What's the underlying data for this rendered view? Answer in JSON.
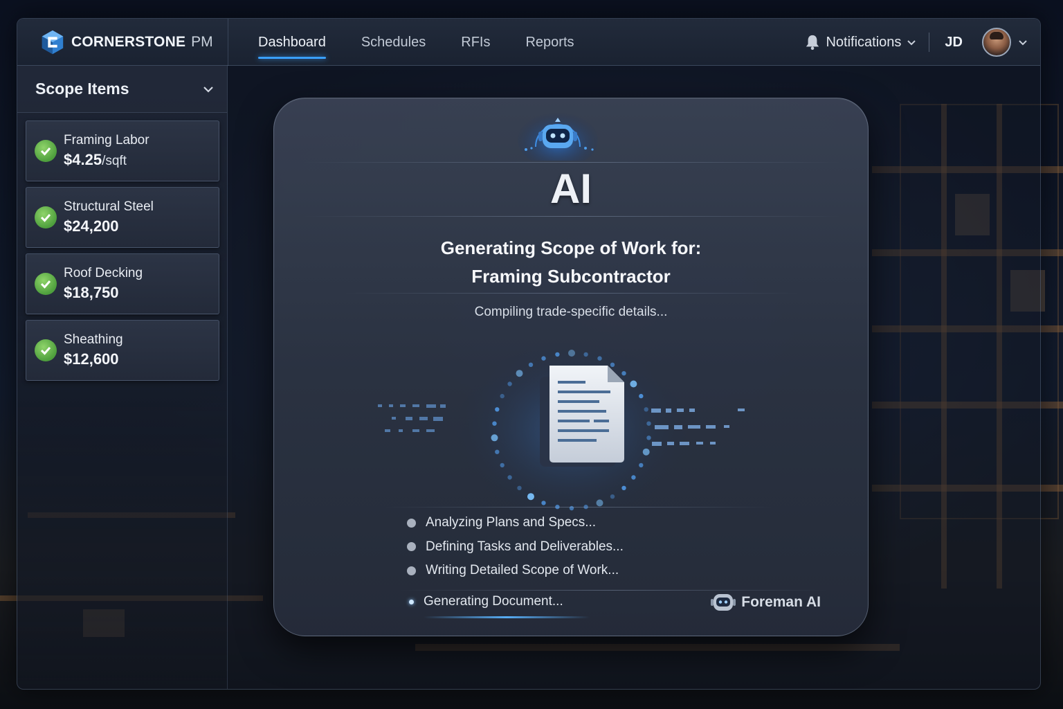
{
  "brand": {
    "name": "CORNERSTONE",
    "suffix": "PM"
  },
  "nav": {
    "tabs": [
      {
        "label": "Dashboard",
        "active": true
      },
      {
        "label": "Schedules",
        "active": false
      },
      {
        "label": "RFIs",
        "active": false
      },
      {
        "label": "Reports",
        "active": false
      }
    ]
  },
  "header": {
    "notifications_label": "Notifications",
    "user_initials": "JD"
  },
  "sidebar": {
    "title": "Scope Items",
    "items": [
      {
        "name": "Framing Labor",
        "price": "$4.25",
        "unit": "/sqft",
        "status": "complete"
      },
      {
        "name": "Structural Steel",
        "price": "$24,200",
        "unit": "",
        "status": "complete"
      },
      {
        "name": "Roof Decking",
        "price": "$18,750",
        "unit": "",
        "status": "complete"
      },
      {
        "name": "Sheathing",
        "price": "$12,600",
        "unit": "",
        "status": "complete"
      }
    ]
  },
  "panel": {
    "ai_label": "AI",
    "title_line1": "Generating Scope of Work for:",
    "title_line2": "Framing Subcontractor",
    "status": "Compiling trade-specific details...",
    "steps": [
      "Analyzing Plans and Specs...",
      "Defining Tasks and Deliverables...",
      "Writing Detailed Scope of Work..."
    ],
    "active_step": "Generating Document...",
    "assistant_name": "Foreman AI"
  },
  "colors": {
    "accent": "#3aa0ff",
    "success": "#5fb347",
    "panel_bg": "#343c4f",
    "background": "#0d1422"
  },
  "icons": {
    "logo": "cube-c-logo-icon",
    "notifications": "bell-icon",
    "robot": "robot-icon",
    "document": "document-icon",
    "check": "check-circle-icon"
  }
}
